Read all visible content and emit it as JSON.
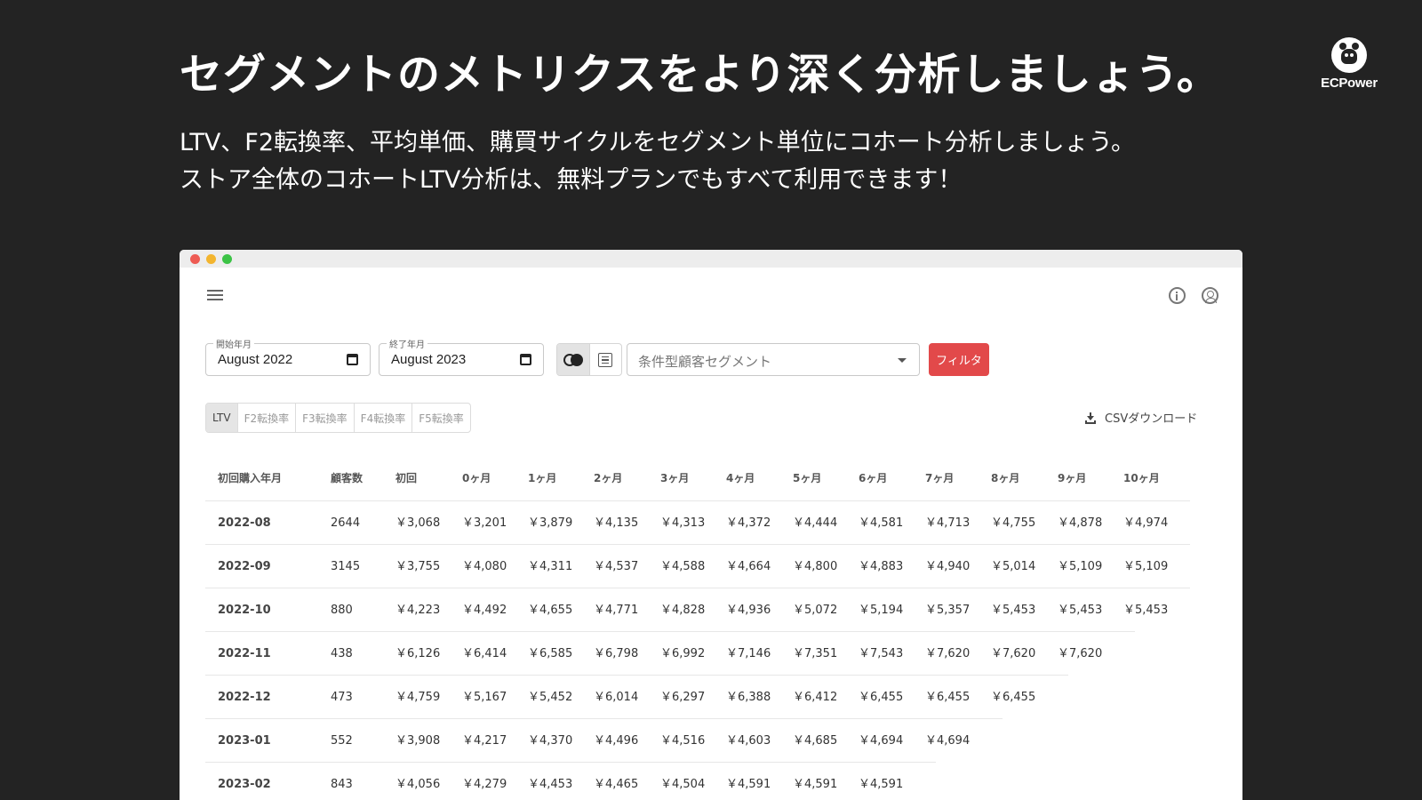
{
  "headline": "セグメントのメトリクスをより深く分析しましょう。",
  "subline1": "LTV、F2転換率、平均単価、購買サイクルをセグメント単位にコホート分析しましょう。",
  "subline2": "ストア全体のコホートLTV分析は、無料プランでもすべて利用できます！",
  "brand": {
    "name": "ECPower",
    "icon": "bear-icon"
  },
  "window_controls": [
    "close",
    "minimize",
    "maximize"
  ],
  "toolbar": {
    "start_label": "開始年月",
    "start_value": "August 2022",
    "end_label": "終了年月",
    "end_value": "August 2023",
    "segment_placeholder": "条件型顧客セグメント",
    "filter_label": "フィルタ",
    "filter_color": "#e2494a"
  },
  "tabs": [
    "LTV",
    "F2転換率",
    "F3転換率",
    "F4転換率",
    "F5転換率"
  ],
  "active_tab": "LTV",
  "csv_label": "CSVダウンロード",
  "table": {
    "headers": [
      "初回購入年月",
      "顧客数",
      "初回",
      "0ヶ月",
      "1ヶ月",
      "2ヶ月",
      "3ヶ月",
      "4ヶ月",
      "5ヶ月",
      "6ヶ月",
      "7ヶ月",
      "8ヶ月",
      "9ヶ月",
      "10ヶ月"
    ],
    "rows": [
      [
        "2022-08",
        "2644",
        "￥3,068",
        "￥3,201",
        "￥3,879",
        "￥4,135",
        "￥4,313",
        "￥4,372",
        "￥4,444",
        "￥4,581",
        "￥4,713",
        "￥4,755",
        "￥4,878",
        "￥4,974"
      ],
      [
        "2022-09",
        "3145",
        "￥3,755",
        "￥4,080",
        "￥4,311",
        "￥4,537",
        "￥4,588",
        "￥4,664",
        "￥4,800",
        "￥4,883",
        "￥4,940",
        "￥5,014",
        "￥5,109",
        "￥5,109"
      ],
      [
        "2022-10",
        "880",
        "￥4,223",
        "￥4,492",
        "￥4,655",
        "￥4,771",
        "￥4,828",
        "￥4,936",
        "￥5,072",
        "￥5,194",
        "￥5,357",
        "￥5,453",
        "￥5,453",
        "￥5,453"
      ],
      [
        "2022-11",
        "438",
        "￥6,126",
        "￥6,414",
        "￥6,585",
        "￥6,798",
        "￥6,992",
        "￥7,146",
        "￥7,351",
        "￥7,543",
        "￥7,620",
        "￥7,620",
        "￥7,620"
      ],
      [
        "2022-12",
        "473",
        "￥4,759",
        "￥5,167",
        "￥5,452",
        "￥6,014",
        "￥6,297",
        "￥6,388",
        "￥6,412",
        "￥6,455",
        "￥6,455",
        "￥6,455"
      ],
      [
        "2023-01",
        "552",
        "￥3,908",
        "￥4,217",
        "￥4,370",
        "￥4,496",
        "￥4,516",
        "￥4,603",
        "￥4,685",
        "￥4,694",
        "￥4,694"
      ],
      [
        "2023-02",
        "843",
        "￥4,056",
        "￥4,279",
        "￥4,453",
        "￥4,465",
        "￥4,504",
        "￥4,591",
        "￥4,591",
        "￥4,591"
      ]
    ]
  }
}
